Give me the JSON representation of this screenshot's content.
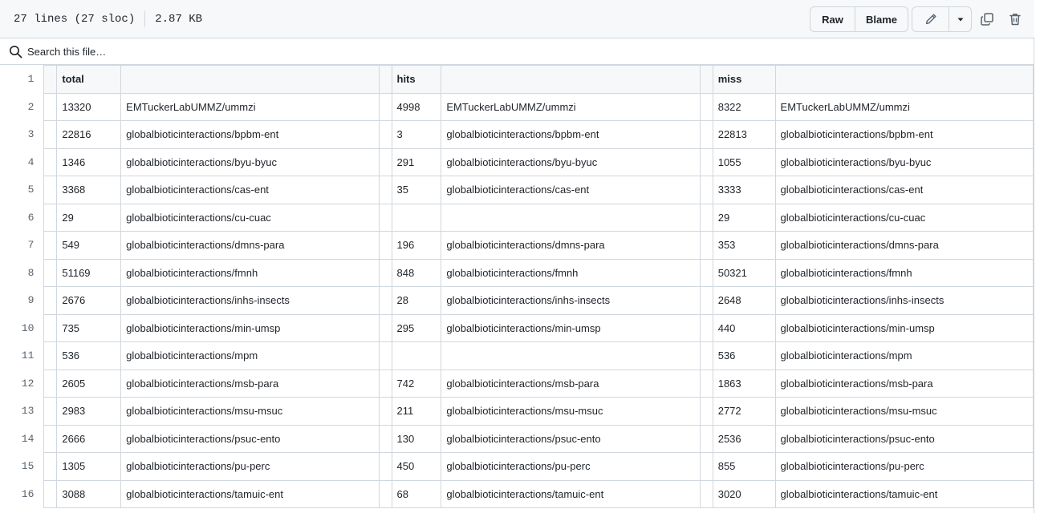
{
  "header": {
    "line_info": "27 lines (27 sloc)",
    "file_size": "2.87 KB",
    "raw_label": "Raw",
    "blame_label": "Blame"
  },
  "search": {
    "placeholder": "Search this file…"
  },
  "table": {
    "header_row": {
      "line": "1",
      "cells": [
        "total",
        "",
        "hits",
        "",
        "miss",
        ""
      ]
    },
    "rows": [
      {
        "line": "2",
        "cells": [
          "13320",
          "EMTuckerLabUMMZ/ummzi",
          "4998",
          "EMTuckerLabUMMZ/ummzi",
          "8322",
          "EMTuckerLabUMMZ/ummzi"
        ]
      },
      {
        "line": "3",
        "cells": [
          "22816",
          "globalbioticinteractions/bpbm-ent",
          "3",
          "globalbioticinteractions/bpbm-ent",
          "22813",
          "globalbioticinteractions/bpbm-ent"
        ]
      },
      {
        "line": "4",
        "cells": [
          "1346",
          "globalbioticinteractions/byu-byuc",
          "291",
          "globalbioticinteractions/byu-byuc",
          "1055",
          "globalbioticinteractions/byu-byuc"
        ]
      },
      {
        "line": "5",
        "cells": [
          "3368",
          "globalbioticinteractions/cas-ent",
          "35",
          "globalbioticinteractions/cas-ent",
          "3333",
          "globalbioticinteractions/cas-ent"
        ]
      },
      {
        "line": "6",
        "cells": [
          "29",
          "globalbioticinteractions/cu-cuac",
          "",
          "",
          "29",
          "globalbioticinteractions/cu-cuac"
        ]
      },
      {
        "line": "7",
        "cells": [
          "549",
          "globalbioticinteractions/dmns-para",
          "196",
          "globalbioticinteractions/dmns-para",
          "353",
          "globalbioticinteractions/dmns-para"
        ]
      },
      {
        "line": "8",
        "cells": [
          "51169",
          "globalbioticinteractions/fmnh",
          "848",
          "globalbioticinteractions/fmnh",
          "50321",
          "globalbioticinteractions/fmnh"
        ]
      },
      {
        "line": "9",
        "cells": [
          "2676",
          "globalbioticinteractions/inhs-insects",
          "28",
          "globalbioticinteractions/inhs-insects",
          "2648",
          "globalbioticinteractions/inhs-insects"
        ]
      },
      {
        "line": "10",
        "cells": [
          "735",
          "globalbioticinteractions/min-umsp",
          "295",
          "globalbioticinteractions/min-umsp",
          "440",
          "globalbioticinteractions/min-umsp"
        ]
      },
      {
        "line": "11",
        "cells": [
          "536",
          "globalbioticinteractions/mpm",
          "",
          "",
          "536",
          "globalbioticinteractions/mpm"
        ]
      },
      {
        "line": "12",
        "cells": [
          "2605",
          "globalbioticinteractions/msb-para",
          "742",
          "globalbioticinteractions/msb-para",
          "1863",
          "globalbioticinteractions/msb-para"
        ]
      },
      {
        "line": "13",
        "cells": [
          "2983",
          "globalbioticinteractions/msu-msuc",
          "211",
          "globalbioticinteractions/msu-msuc",
          "2772",
          "globalbioticinteractions/msu-msuc"
        ]
      },
      {
        "line": "14",
        "cells": [
          "2666",
          "globalbioticinteractions/psuc-ento",
          "130",
          "globalbioticinteractions/psuc-ento",
          "2536",
          "globalbioticinteractions/psuc-ento"
        ]
      },
      {
        "line": "15",
        "cells": [
          "1305",
          "globalbioticinteractions/pu-perc",
          "450",
          "globalbioticinteractions/pu-perc",
          "855",
          "globalbioticinteractions/pu-perc"
        ]
      },
      {
        "line": "16",
        "cells": [
          "3088",
          "globalbioticinteractions/tamuic-ent",
          "68",
          "globalbioticinteractions/tamuic-ent",
          "3020",
          "globalbioticinteractions/tamuic-ent"
        ]
      }
    ]
  },
  "icons": {
    "search": "search-icon",
    "edit": "pencil-icon",
    "dropdown": "triangle-down-icon",
    "copy": "copy-icon",
    "delete": "trash-icon"
  }
}
